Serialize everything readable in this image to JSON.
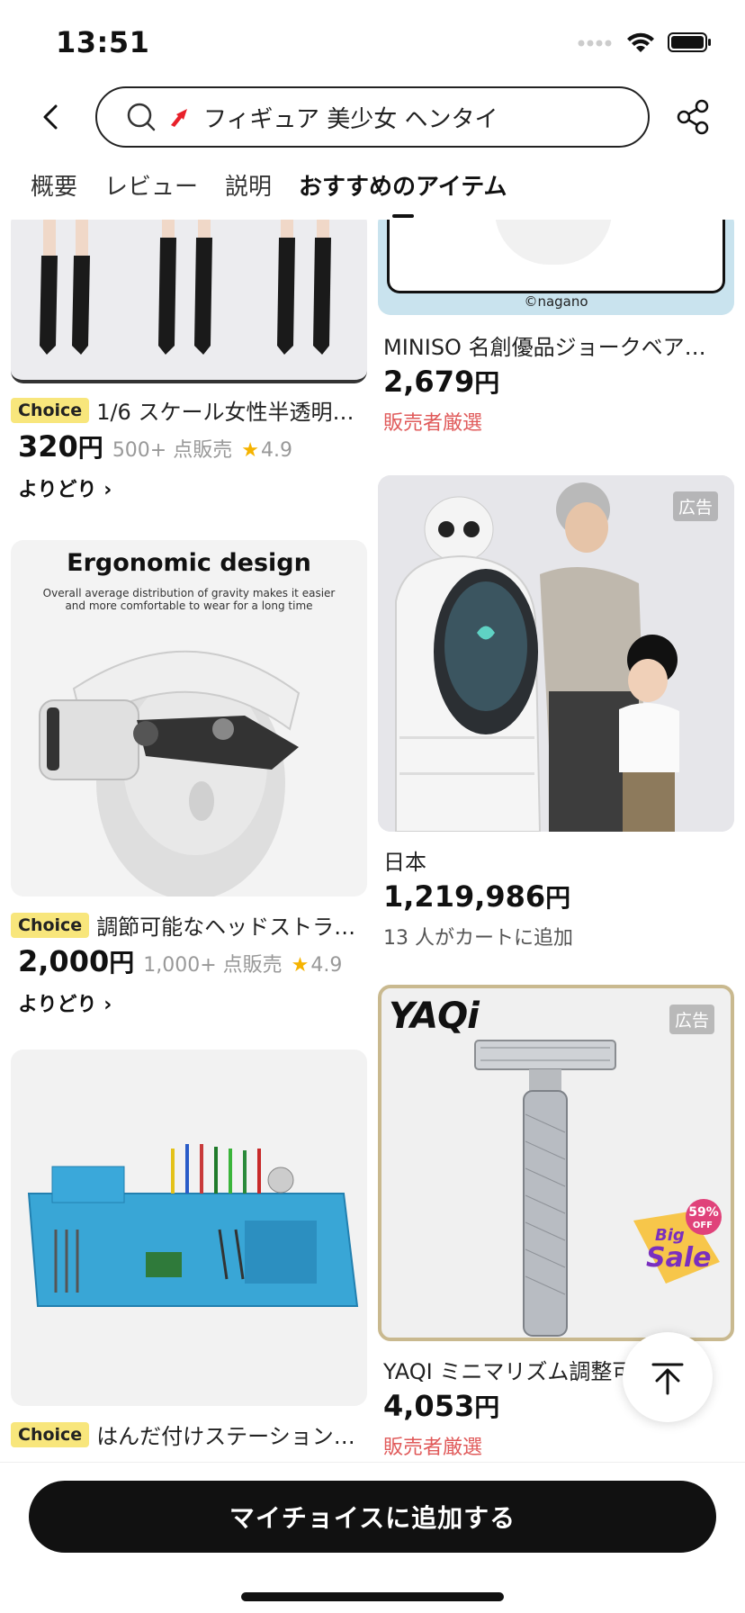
{
  "status": {
    "time": "13:51"
  },
  "search": {
    "query": "フィギュア 美少女 ヘンタイ"
  },
  "tabs": [
    {
      "label": "概要"
    },
    {
      "label": "レビュー"
    },
    {
      "label": "説明"
    },
    {
      "label": "おすすめのアイテム"
    }
  ],
  "products": {
    "p1": {
      "badge": "Choice",
      "title": "1/6 スケール女性半透明…",
      "price": "320",
      "yen": "円",
      "sold": "500+ 点販売",
      "rating": "4.9",
      "link": "よりどり ›"
    },
    "p2": {
      "image_caption": "©nagano",
      "title": "MINISO 名創優品ジョークベア…",
      "price": "2,679",
      "yen": "円",
      "note": "販売者厳選"
    },
    "p3": {
      "image_heading": "Ergonomic design",
      "image_sub": "Overall average distribution of gravity makes it easier and more comfortable to wear for a long time",
      "badge": "Choice",
      "title": "調節可能なヘッドストラ…",
      "price": "2,000",
      "yen": "円",
      "sold": "1,000+ 点販売",
      "rating": "4.9",
      "link": "よりどり ›"
    },
    "p4": {
      "ad": "広告",
      "title": "日本",
      "price": "1,219,986",
      "yen": "円",
      "note": "13 人がカートに追加"
    },
    "p5": {
      "badge": "Choice",
      "title": "はんだ付けステーション…"
    },
    "p6": {
      "ad": "広告",
      "brand": "YAQi",
      "sale_pct": "59%",
      "sale_off": "OFF",
      "sale_big": "Big",
      "sale_word": "Sale",
      "title": "YAQI ミニマリズム調整可",
      "price": "4,053",
      "yen": "円",
      "note": "販売者厳選"
    }
  },
  "bottom": {
    "button": "マイチョイスに追加する"
  },
  "colors": {
    "accent_red": "#e05a5a",
    "choice_yellow": "#f8e67c",
    "star": "#f5b300"
  }
}
